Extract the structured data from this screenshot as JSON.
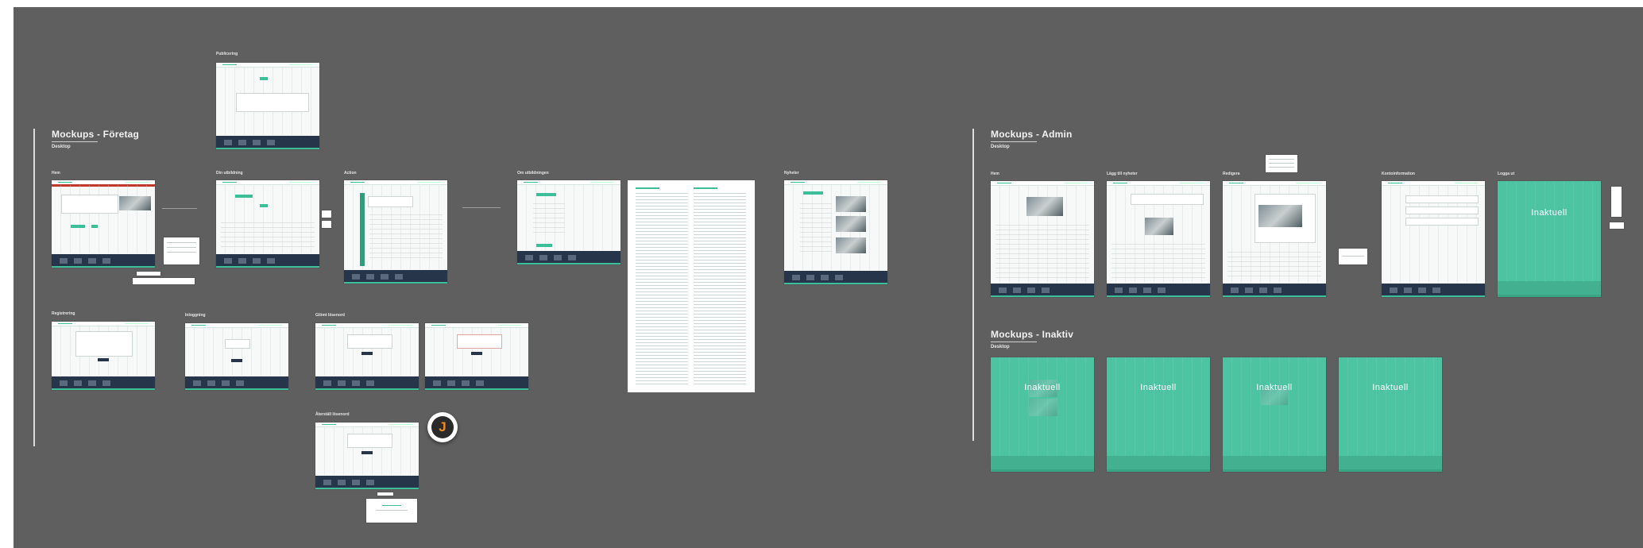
{
  "sections": {
    "foretag": {
      "title": "Mockups - Företag",
      "subtitle": "Desktop"
    },
    "admin": {
      "title": "Mockups - Admin",
      "subtitle": "Desktop"
    },
    "inaktiv": {
      "title": "Mockups - Inaktiv",
      "subtitle": "Desktop"
    }
  },
  "frame_labels": {
    "publicering": "Publicering",
    "hem": "Hem",
    "din_utbildning": "Din utbildning",
    "action": "Action",
    "om_utbildningen": "Om utbildningen",
    "nyheter": "Nyheter",
    "registrering": "Registrering",
    "inloggning": "Inloggning",
    "glomt_losenord": "Glömt lösenord",
    "aterstall_losenord": "Återställ lösenord",
    "admin_hem": "Hem",
    "lagg_till_nyheter": "Lägg till nyheter",
    "redigera": "Redigera",
    "kontoinformation": "Kontoinformation",
    "logga_ut": "Logga ut"
  },
  "overlay_text": {
    "inaktuell": "Inaktuell"
  },
  "avatar": {
    "initial": "J"
  },
  "colors": {
    "canvas": "#5f5f5f",
    "accent": "#3cbf98",
    "inactive": "#4cc3a1",
    "footer": "#27354a",
    "avatar_letter": "#f08a24"
  }
}
